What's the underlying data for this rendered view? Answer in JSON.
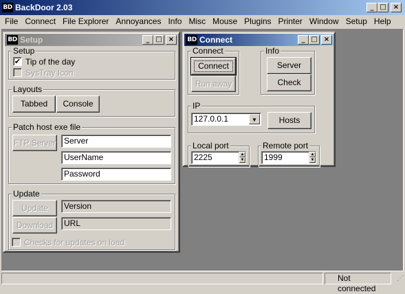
{
  "app": {
    "title": "BackDoor  2.03",
    "icon_text": "BD",
    "controls": {
      "minimize": "_",
      "maximize": "□",
      "close": "×"
    }
  },
  "menu": [
    "File",
    "Connect",
    "File Explorer",
    "Annoyances",
    "Info",
    "Misc",
    "Mouse",
    "Plugins",
    "Printer",
    "Window",
    "Setup",
    "Help"
  ],
  "setup_window": {
    "title": "Setup",
    "setup_group": {
      "legend": "Setup",
      "tip_of_day": {
        "label": "Tip of the day",
        "checked": true
      },
      "systray": {
        "label": "SysTray Icon",
        "checked": false
      }
    },
    "layouts_group": {
      "legend": "Layouts",
      "tabbed": "Tabbed",
      "console": "Console"
    },
    "patch_group": {
      "legend": "Patch host exe file",
      "ftp_server": "FTP Server",
      "server": "Server",
      "username": "UserName",
      "password": "Password"
    },
    "update_group": {
      "legend": "Update",
      "update": "Update",
      "download": "Download",
      "version": "Version",
      "url": "URL",
      "checks_label": "Checks for updates on load"
    }
  },
  "connect_window": {
    "title": "Connect",
    "connect_group": {
      "legend": "Connect",
      "connect": "Connect",
      "run_away": "Run away"
    },
    "info_group": {
      "legend": "Info",
      "server": "Server",
      "check": "Check"
    },
    "ip_group": {
      "legend": "IP",
      "ip_value": "127.0.0.1",
      "hosts": "Hosts"
    },
    "local_port": {
      "legend": "Local port",
      "value": "2225"
    },
    "remote_port": {
      "legend": "Remote port",
      "value": "1999"
    }
  },
  "status": {
    "text": "Not connected"
  }
}
